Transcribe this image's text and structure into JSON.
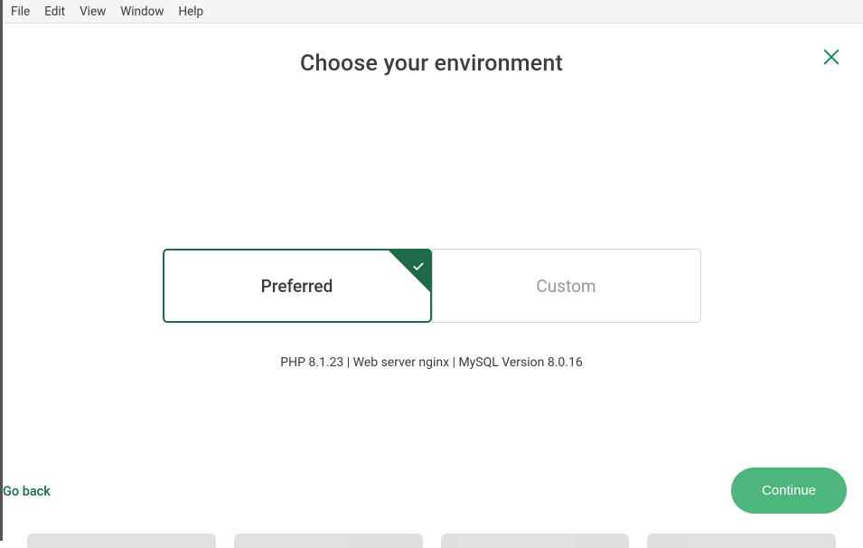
{
  "menu": {
    "items": [
      "File",
      "Edit",
      "View",
      "Window",
      "Help"
    ]
  },
  "header": {
    "title": "Choose your environment"
  },
  "options": {
    "preferred": "Preferred",
    "custom": "Custom"
  },
  "env_details": "PHP 8.1.23 | Web server nginx | MySQL Version 8.0.16",
  "footer": {
    "go_back": "Go back",
    "continue": "Continue"
  }
}
